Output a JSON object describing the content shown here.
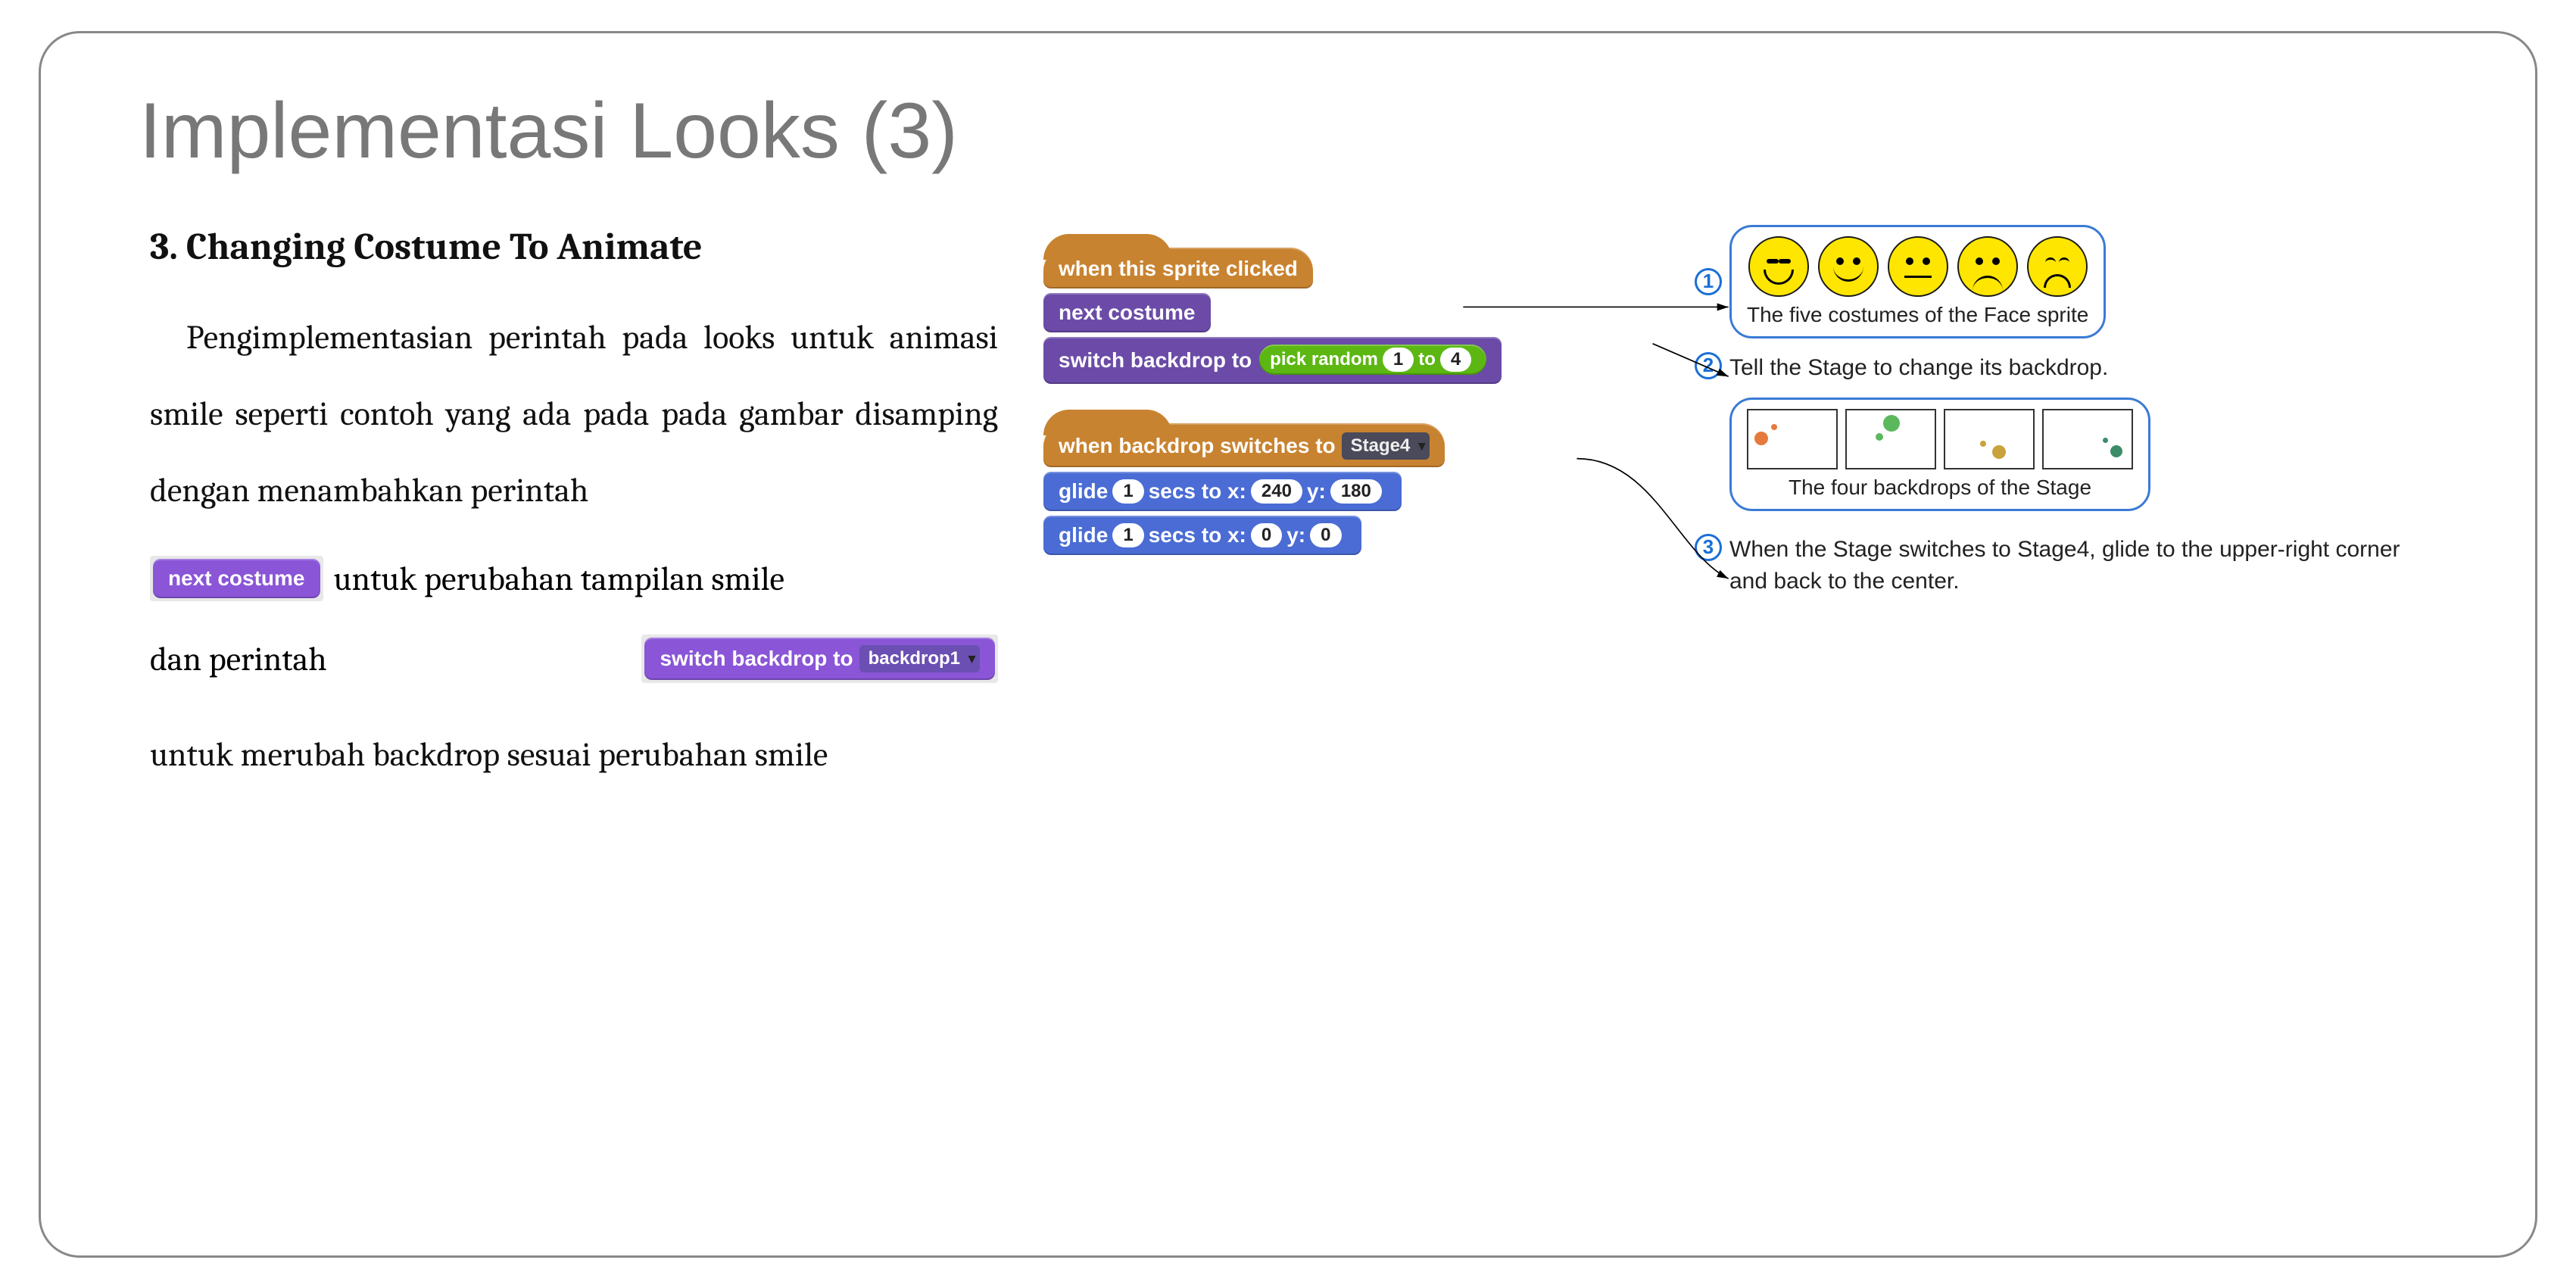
{
  "title": "Implementasi Looks (3)",
  "subheading": "3. Changing Costume To Animate",
  "body": {
    "p1": "Pengimplementasian perintah  pada looks untuk  animasi smile seperti contoh yang ada pada pada gambar disamping dengan menambahkan perintah",
    "p2_suffix": "untuk perubahan tampilan smile",
    "p3_prefix": "dan perintah",
    "p4": "untuk merubah backdrop sesuai perubahan smile"
  },
  "inline_blocks": {
    "next_costume": "next costume",
    "switch_backdrop": "switch backdrop to",
    "switch_backdrop_val": "backdrop1"
  },
  "script1": {
    "hat": "when this sprite clicked",
    "b1": "next costume",
    "b2_pre": "switch backdrop to",
    "b2_op_pre": "pick random",
    "b2_op_v1": "1",
    "b2_op_mid": "to",
    "b2_op_v2": "4"
  },
  "script2": {
    "hat_pre": "when backdrop switches to",
    "hat_val": "Stage4",
    "g1_pre": "glide",
    "g1_secs": "1",
    "g1_mid": "secs to x:",
    "g1_x": "240",
    "g1_mid2": "y:",
    "g1_y": "180",
    "g2_pre": "glide",
    "g2_secs": "1",
    "g2_mid": "secs to x:",
    "g2_x": "0",
    "g2_mid2": "y:",
    "g2_y": "0"
  },
  "annotations": {
    "n1": "1",
    "t1": "The five costumes of the Face sprite",
    "n2": "2",
    "t2": "Tell the Stage to change its backdrop.",
    "t2b": "The four backdrops of the Stage",
    "n3": "3",
    "t3": "When the Stage switches to Stage4, glide to the upper-right corner and back to the center."
  }
}
